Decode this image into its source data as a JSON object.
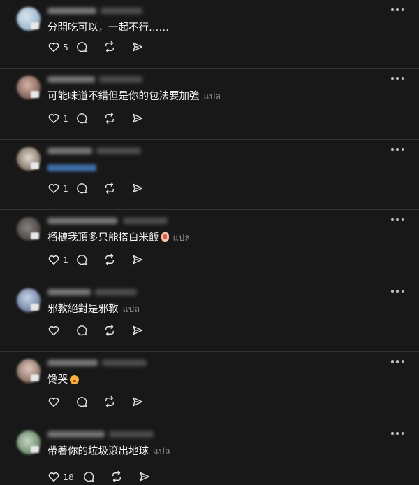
{
  "translate_label": "แปล",
  "posts": [
    {
      "text": "分開吃可以，一起不行……",
      "likes": "5",
      "translate": false,
      "avatar_color": "#a9c3d8"
    },
    {
      "text": "可能味道不錯但是你的包法要加強",
      "likes": "1",
      "translate": true,
      "avatar_color": "#9a6e66"
    },
    {
      "text": "",
      "likes": "1",
      "translate": false,
      "avatar_color": "#b0a296",
      "link": true
    },
    {
      "text": "榴槤我頂多只能搭白米飯",
      "likes": "1",
      "translate": true,
      "avatar_color": "#5f5a58",
      "emoji": "raised-hand-emoji"
    },
    {
      "text": "邪教絕對是邪教",
      "likes": "",
      "translate": true,
      "avatar_color": "#8ea5c6"
    },
    {
      "text": "馋哭",
      "likes": "",
      "translate": false,
      "avatar_color": "#b79b8f",
      "emoji": "face-emoji"
    },
    {
      "text": "帶著你的垃圾滾出地球",
      "likes": "18",
      "translate": true,
      "avatar_color": "#7f9c7e"
    }
  ]
}
